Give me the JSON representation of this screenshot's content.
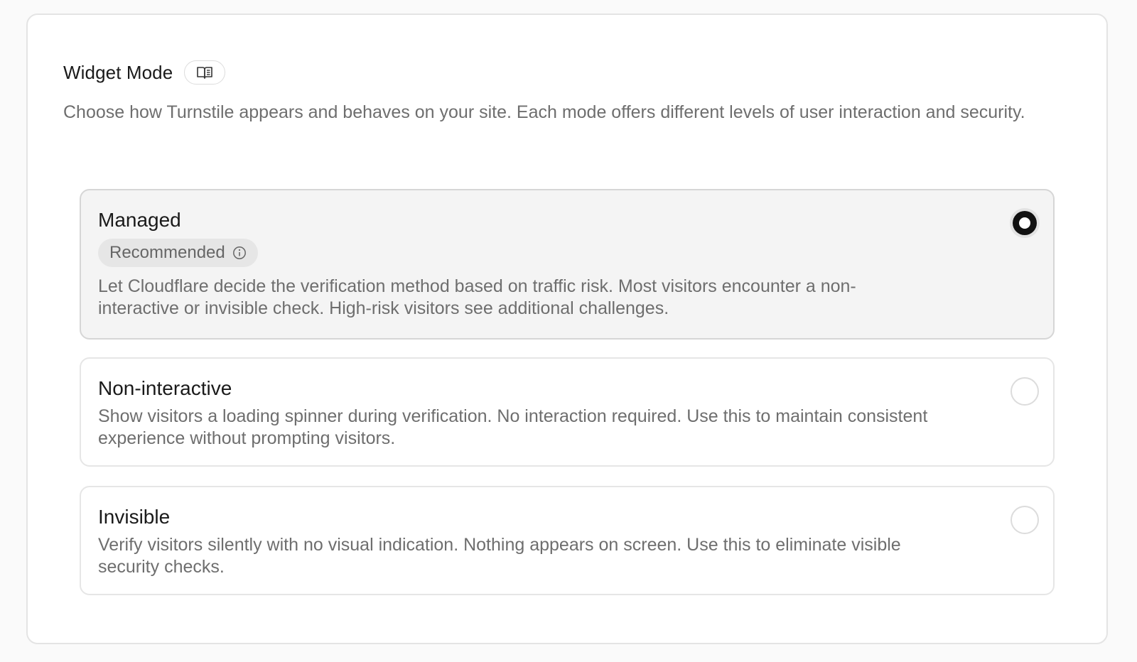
{
  "widget_mode": {
    "title": "Widget Mode",
    "doc_button_icon": "book-icon",
    "description": "Choose how Turnstile appears and behaves on your site. Each mode offers different levels of user interaction and security."
  },
  "options": [
    {
      "title": "Managed",
      "badge": "Recommended",
      "description": "Let Cloudflare decide the verification method based on traffic risk. Most visitors encounter a non-interactive or invisible check. High-risk visitors see additional challenges.",
      "selected": true
    },
    {
      "title": "Non-interactive",
      "description": "Show visitors a loading spinner during verification. No interaction required. Use this to maintain consistent experience without prompting visitors.",
      "selected": false
    },
    {
      "title": "Invisible",
      "description": "Verify visitors silently with no visual indication. Nothing appears on screen. Use this to eliminate visible security checks.",
      "selected": false
    }
  ],
  "colors": {
    "selected_radio": "#111111",
    "selected_background": "#f4f4f4",
    "muted_text": "#6e6e6e"
  }
}
